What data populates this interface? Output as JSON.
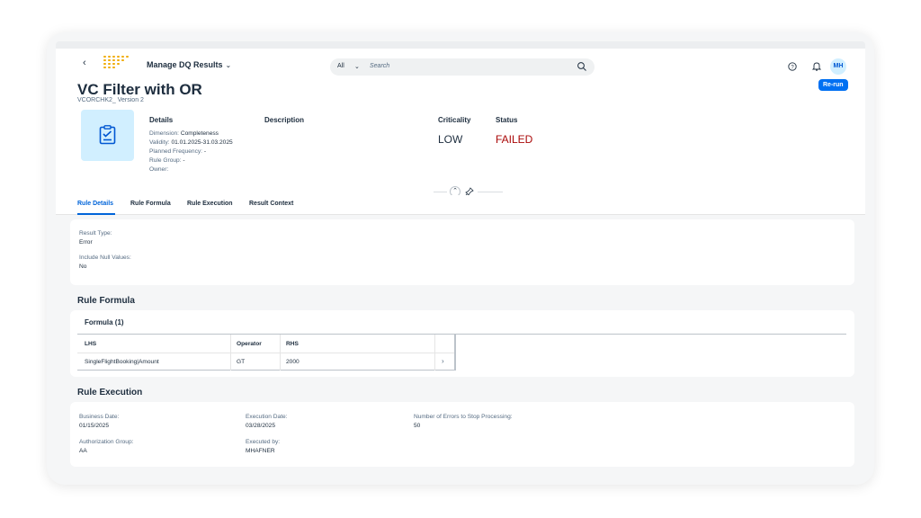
{
  "shell": {
    "app_title": "Manage DQ Results",
    "search_scope": "All",
    "search_placeholder": "Search",
    "user_initials": "MH"
  },
  "header": {
    "title": "VC Filter with OR",
    "subtitle": "VCORCHK2_ Version 2",
    "rerun_label": "Re-run",
    "details_title": "Details",
    "description_title": "Description",
    "criticality_title": "Criticality",
    "criticality_value": "LOW",
    "status_title": "Status",
    "status_value": "FAILED",
    "details": {
      "dimension_label": "Dimension:",
      "dimension_value": "Completeness",
      "validity_label": "Validity:",
      "validity_value": "01.01.2025-31.03.2025",
      "frequency_label": "Planned Frequency:",
      "frequency_value": "-",
      "rule_group_label": "Rule Group:",
      "rule_group_value": "-",
      "owner_label": "Owner:",
      "owner_value": ""
    }
  },
  "tabs": [
    {
      "label": "Rule Details"
    },
    {
      "label": "Rule Formula"
    },
    {
      "label": "Rule Execution"
    },
    {
      "label": "Result Context"
    }
  ],
  "rule_details": {
    "result_type_label": "Result Type:",
    "result_type_value": "Error",
    "include_null_label": "Include Null Values:",
    "include_null_value": "No"
  },
  "rule_formula": {
    "heading": "Rule Formula",
    "table_title": "Formula (1)",
    "columns": [
      "LHS",
      "Operator",
      "RHS"
    ],
    "rows": [
      {
        "lhs": "SingleFlightBooking|Amount",
        "operator": "GT",
        "rhs": "2000"
      }
    ]
  },
  "rule_execution": {
    "heading": "Rule Execution",
    "business_date_label": "Business Date:",
    "business_date_value": "01/15/2025",
    "execution_date_label": "Execution Date:",
    "execution_date_value": "03/28/2025",
    "errors_label": "Number of Errors to Stop Processing:",
    "errors_value": "50",
    "auth_group_label": "Authorization Group:",
    "auth_group_value": "AA",
    "executed_by_label": "Executed by:",
    "executed_by_value": "MHAFNER"
  },
  "colors": {
    "accent": "#0070f2",
    "status_failed": "#aa0808",
    "logo": "#f0ab00"
  },
  "icons": [
    "back-chevron-icon",
    "app-logo-icon",
    "search-icon",
    "help-icon",
    "bell-icon",
    "checklist-icon",
    "collapse-header-icon",
    "pin-icon",
    "row-navigation-icon"
  ]
}
